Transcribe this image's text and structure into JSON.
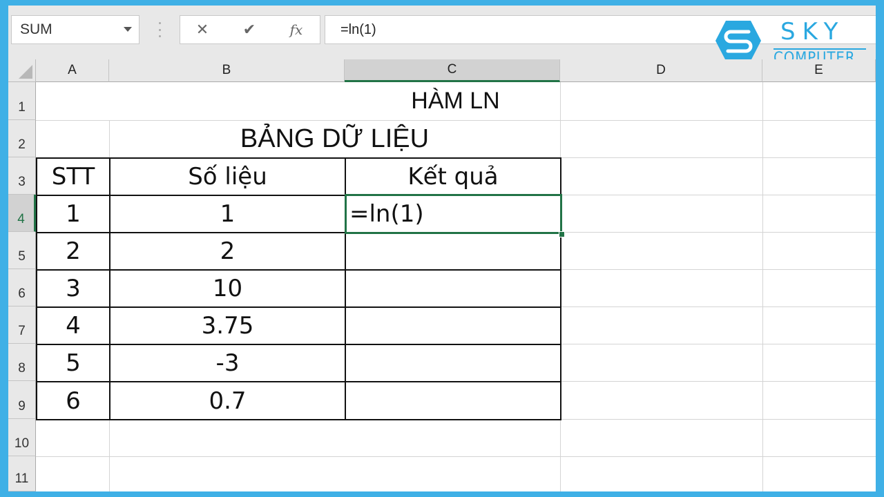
{
  "formula_bar": {
    "name_box": "SUM",
    "cancel_icon": "✕",
    "enter_icon": "✔",
    "fx_icon": "fx",
    "formula": "=ln(1)"
  },
  "logo": {
    "name": "SKY",
    "sub": "COMPUTER"
  },
  "columns": [
    "A",
    "B",
    "C",
    "D",
    "E"
  ],
  "selected_column": "C",
  "rows": [
    "1",
    "2",
    "3",
    "4",
    "5",
    "6",
    "7",
    "8",
    "9",
    "10",
    "11"
  ],
  "selected_row": "4",
  "sheet": {
    "title": "HÀM LN",
    "subtitle": "BẢNG DỮ LIỆU",
    "headers": [
      "STT",
      "Số liệu",
      "Kết quả"
    ],
    "data": [
      {
        "stt": "1",
        "value": "1",
        "result": "=ln(1)"
      },
      {
        "stt": "2",
        "value": "2",
        "result": ""
      },
      {
        "stt": "3",
        "value": "10",
        "result": ""
      },
      {
        "stt": "4",
        "value": "3.75",
        "result": ""
      },
      {
        "stt": "5",
        "value": "-3",
        "result": ""
      },
      {
        "stt": "6",
        "value": "0.7",
        "result": ""
      }
    ]
  },
  "colors": {
    "frame": "#3fb0e6",
    "excel_green": "#217346",
    "logo": "#2aa8e0"
  }
}
